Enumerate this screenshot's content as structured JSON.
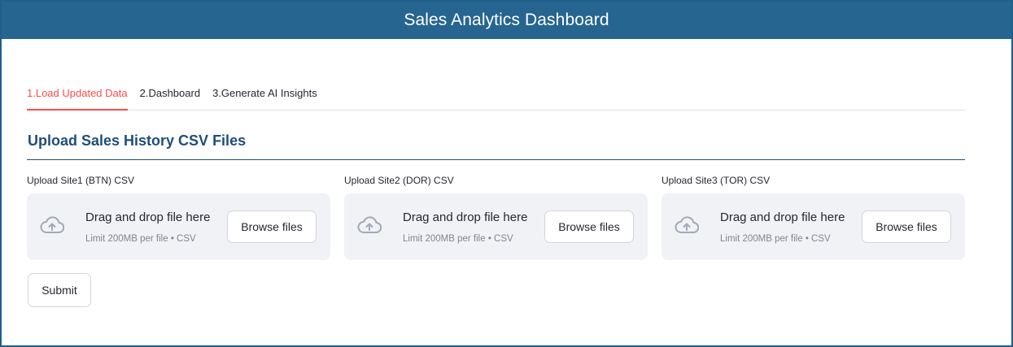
{
  "header": {
    "title": "Sales Analytics Dashboard",
    "background": "#26658f"
  },
  "tabs": [
    {
      "label": "1.Load Updated Data",
      "active": true
    },
    {
      "label": "2.Dashboard",
      "active": false
    },
    {
      "label": "3.Generate AI Insights",
      "active": false
    }
  ],
  "colors": {
    "accent": "#ff4b4b",
    "section_title": "#1f4e79",
    "dropzone_bg": "#f0f2f6"
  },
  "section": {
    "title": "Upload Sales History CSV Files"
  },
  "uploaders": [
    {
      "label": "Upload Site1 (BTN) CSV",
      "drop_text": "Drag and drop file here",
      "limit_text": "Limit 200MB per file • CSV",
      "button_label": "Browse files",
      "icon": "cloud-upload-icon"
    },
    {
      "label": "Upload Site2 (DOR) CSV",
      "drop_text": "Drag and drop file here",
      "limit_text": "Limit 200MB per file • CSV",
      "button_label": "Browse files",
      "icon": "cloud-upload-icon"
    },
    {
      "label": "Upload Site3 (TOR) CSV",
      "drop_text": "Drag and drop file here",
      "limit_text": "Limit 200MB per file • CSV",
      "button_label": "Browse files",
      "icon": "cloud-upload-icon"
    }
  ],
  "submit": {
    "label": "Submit"
  }
}
